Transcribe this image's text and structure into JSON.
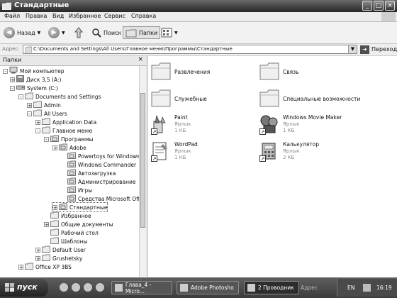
{
  "window": {
    "title": "Стандартные",
    "controls": [
      "_",
      "□",
      "×"
    ]
  },
  "menu": [
    "Файл",
    "Правка",
    "Вид",
    "Избранное",
    "Сервис",
    "Справка"
  ],
  "toolbar": {
    "back_label": "Назад",
    "search_label": "Поиск",
    "folders_label": "Папки"
  },
  "address": {
    "label": "Адрес:",
    "value": "C:\\Documents and Settings\\All Users\\Главное меню\\Программы\\Стандартные",
    "go_label": "Переход"
  },
  "folders_pane": {
    "title": "Папки",
    "close": "×",
    "tree": [
      {
        "label": "Мой компьютер",
        "exp": "-",
        "icon": "computer-icon"
      },
      {
        "label": "Диск 3,5 (A:)",
        "exp": "+",
        "icon": "floppy-icon"
      },
      {
        "label": "System (C:)",
        "exp": "-",
        "icon": "drive-icon"
      },
      {
        "label": "Documents and Settings",
        "exp": "-",
        "icon": "folder-icon"
      },
      {
        "label": "Admin",
        "exp": "+",
        "icon": "folder-icon"
      },
      {
        "label": "All Users",
        "exp": "-",
        "icon": "folder-icon"
      },
      {
        "label": "Application Data",
        "exp": "+",
        "icon": "folder-icon"
      },
      {
        "label": "Главное меню",
        "exp": "-",
        "icon": "folder-icon"
      },
      {
        "label": "Программы",
        "exp": "-",
        "icon": "programs-folder-icon"
      },
      {
        "label": "Adobe",
        "exp": "+",
        "icon": "programs-folder-icon"
      },
      {
        "label": "Powertoys for Windows X",
        "exp": "",
        "icon": "programs-folder-icon"
      },
      {
        "label": "Windows Commander",
        "exp": "",
        "icon": "programs-folder-icon"
      },
      {
        "label": "Автозагрузка",
        "exp": "",
        "icon": "programs-folder-icon"
      },
      {
        "label": "Администрирование",
        "exp": "",
        "icon": "programs-folder-icon"
      },
      {
        "label": "Игры",
        "exp": "",
        "icon": "programs-folder-icon"
      },
      {
        "label": "Средства Microsoft Offic",
        "exp": "",
        "icon": "programs-folder-icon"
      },
      {
        "label": "Стандартные",
        "exp": "+",
        "icon": "programs-folder-icon"
      },
      {
        "label": "Избранное",
        "exp": "",
        "icon": "folder-icon"
      },
      {
        "label": "Общие документы",
        "exp": "+",
        "icon": "folder-icon"
      },
      {
        "label": "Рабочий стол",
        "exp": "",
        "icon": "folder-icon"
      },
      {
        "label": "Шаблоны",
        "exp": "",
        "icon": "folder-icon"
      },
      {
        "label": "Default User",
        "exp": "+",
        "icon": "folder-icon"
      },
      {
        "label": "Grushetsky",
        "exp": "+",
        "icon": "folder-icon"
      },
      {
        "label": "Office XP 3BS",
        "exp": "+",
        "icon": "folder-icon"
      }
    ]
  },
  "content": {
    "items": [
      {
        "name": "Развлечения",
        "type": "",
        "size": "",
        "icon": "folder-icon"
      },
      {
        "name": "Связь",
        "type": "",
        "size": "",
        "icon": "folder-icon"
      },
      {
        "name": "Служебные",
        "type": "",
        "size": "",
        "icon": "folder-icon"
      },
      {
        "name": "Специальные возможности",
        "type": "",
        "size": "",
        "icon": "folder-icon"
      },
      {
        "name": "Paint",
        "type": "Ярлык",
        "size": "1 КБ",
        "icon": "paint-icon"
      },
      {
        "name": "Windows Movie Maker",
        "type": "Ярлык",
        "size": "1 КБ",
        "icon": "movie-maker-icon"
      },
      {
        "name": "WordPad",
        "type": "Ярлык",
        "size": "1 КБ",
        "icon": "wordpad-icon"
      },
      {
        "name": "Калькулятор",
        "type": "Ярлык",
        "size": "2 КБ",
        "icon": "calculator-icon"
      }
    ]
  },
  "taskbar": {
    "start_label": "пуск",
    "tasks": [
      {
        "label": "Глава_4 - Micro..."
      },
      {
        "label": "Adobe Photosho"
      },
      {
        "label": "2 Проводник"
      }
    ],
    "tray_address": "Адрес",
    "lang": "EN",
    "clock": "16:19"
  }
}
